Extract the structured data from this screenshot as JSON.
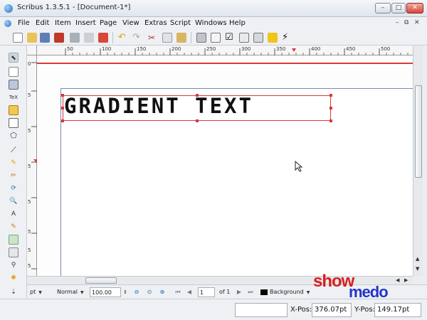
{
  "window": {
    "title": "Scribus 1.3.5.1 - [Document-1*]",
    "controls": {
      "minimize": "–",
      "maximize": "□",
      "close": "✕"
    }
  },
  "menubar": {
    "items": [
      "File",
      "Edit",
      "Item",
      "Insert",
      "Page",
      "View",
      "Extras",
      "Script",
      "Windows",
      "Help"
    ],
    "mdi_controls": {
      "minimize": "–",
      "restore": "⧉",
      "close": "✕"
    }
  },
  "toolbar": {
    "icons": [
      "new-document",
      "open",
      "save",
      "close",
      "print",
      "pdf-export",
      "undo",
      "redo",
      "cut",
      "copy",
      "paste",
      "text-frame",
      "properties",
      "checkbox",
      "list",
      "combo",
      "note",
      "script"
    ]
  },
  "toolbox": {
    "tools": [
      "select",
      "text-frame",
      "image-frame",
      "render-frame",
      "table",
      "shape",
      "polygon",
      "line",
      "bezier",
      "freehand",
      "rotate",
      "zoom",
      "edit-content",
      "edit-text",
      "link-frames",
      "unlink-frames",
      "measure",
      "copy-properties",
      "eyedropper"
    ],
    "render_label": "TeX"
  },
  "rulers": {
    "top_labels": [
      "50",
      "100",
      "150",
      "200",
      "250",
      "300",
      "350",
      "400",
      "450",
      "500"
    ],
    "left_labels": [
      "0",
      "5",
      "5",
      "5",
      "5",
      "5",
      "5",
      "5"
    ]
  },
  "canvas": {
    "frame_text": "GRADIENT TEXT"
  },
  "controlbar": {
    "unit": "pt",
    "display_mode": "Normal",
    "zoom": "100.00 %",
    "page_current": "1",
    "page_of": "of 1",
    "layer": "Background"
  },
  "statusbar": {
    "x_label": "X-Pos:",
    "x_value": "376.07pt",
    "y_label": "Y-Pos:",
    "y_value": "149.17pt"
  },
  "watermark": {
    "part1": "show",
    "part2": "medo"
  },
  "colors": {
    "selection": "#d63a3a",
    "page_border": "#7a86b8",
    "watermark_red": "#d71f1f",
    "watermark_blue": "#2235c8"
  }
}
